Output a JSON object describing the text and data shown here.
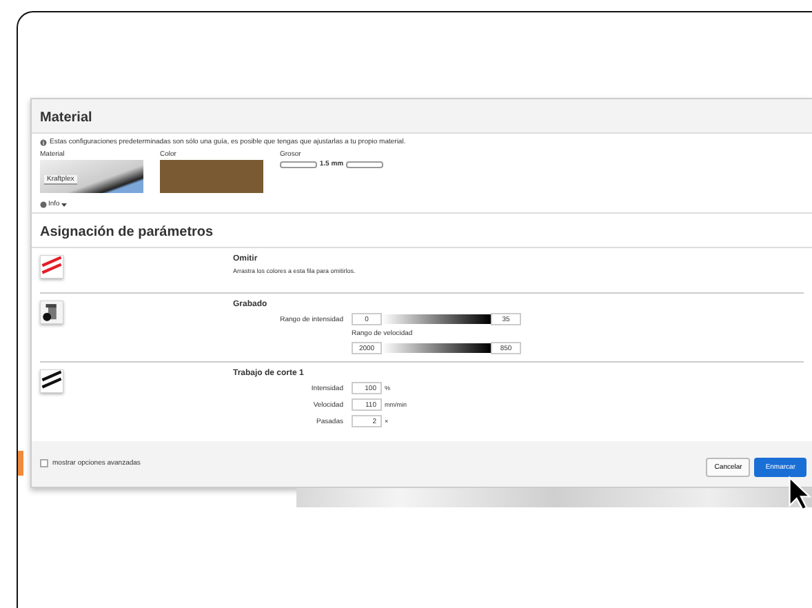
{
  "material": {
    "title": "Material",
    "note": "Estas configuraciones predeterminadas son sólo una guía, es posible que tengas que ajustarlas a tu propio material.",
    "material_label": "Material",
    "material_name": "Kraftplex",
    "color_label": "Color",
    "color": "#7a5a32",
    "thickness_label": "Grosor",
    "thickness": "1.5 mm",
    "info": "Info"
  },
  "assignment": {
    "title": "Asignación de parámetros",
    "rows": [
      {
        "kind": "skip",
        "name": "Omitir",
        "description": "Arrastra los colores a esta fila para omitirlos."
      },
      {
        "kind": "engrave",
        "name": "Grabado",
        "power_label": "Rango de intensidad",
        "power_min": "0",
        "power_max": "35",
        "speed_label": "Rango de velocidad",
        "speed_min": "2000",
        "speed_max": "850"
      },
      {
        "kind": "cut",
        "name": "Trabajo de corte 1",
        "fields": [
          {
            "label": "Intensidad",
            "value": "100",
            "unit": "%"
          },
          {
            "label": "Velocidad",
            "value": "110",
            "unit": "mm/min"
          },
          {
            "label": "Pasadas",
            "value": "2",
            "unit": "×"
          }
        ]
      }
    ]
  },
  "footer": {
    "advanced_label": "mostrar opciones avanzadas",
    "advanced_checked": false,
    "cancel": "Cancelar",
    "submit": "Enmarcar"
  }
}
